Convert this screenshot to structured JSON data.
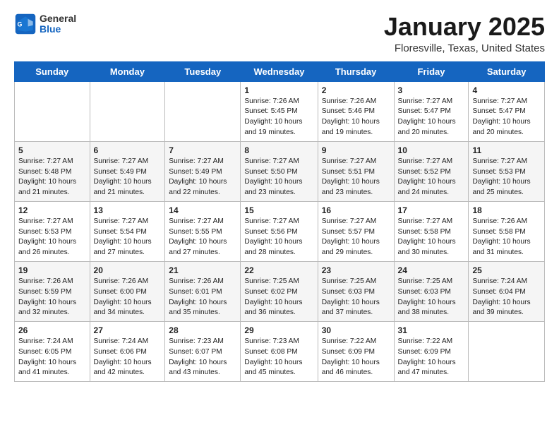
{
  "header": {
    "logo_general": "General",
    "logo_blue": "Blue",
    "month_title": "January 2025",
    "location": "Floresville, Texas, United States"
  },
  "days_of_week": [
    "Sunday",
    "Monday",
    "Tuesday",
    "Wednesday",
    "Thursday",
    "Friday",
    "Saturday"
  ],
  "weeks": [
    [
      {
        "num": "",
        "info": ""
      },
      {
        "num": "",
        "info": ""
      },
      {
        "num": "",
        "info": ""
      },
      {
        "num": "1",
        "info": "Sunrise: 7:26 AM\nSunset: 5:45 PM\nDaylight: 10 hours\nand 19 minutes."
      },
      {
        "num": "2",
        "info": "Sunrise: 7:26 AM\nSunset: 5:46 PM\nDaylight: 10 hours\nand 19 minutes."
      },
      {
        "num": "3",
        "info": "Sunrise: 7:27 AM\nSunset: 5:47 PM\nDaylight: 10 hours\nand 20 minutes."
      },
      {
        "num": "4",
        "info": "Sunrise: 7:27 AM\nSunset: 5:47 PM\nDaylight: 10 hours\nand 20 minutes."
      }
    ],
    [
      {
        "num": "5",
        "info": "Sunrise: 7:27 AM\nSunset: 5:48 PM\nDaylight: 10 hours\nand 21 minutes."
      },
      {
        "num": "6",
        "info": "Sunrise: 7:27 AM\nSunset: 5:49 PM\nDaylight: 10 hours\nand 21 minutes."
      },
      {
        "num": "7",
        "info": "Sunrise: 7:27 AM\nSunset: 5:49 PM\nDaylight: 10 hours\nand 22 minutes."
      },
      {
        "num": "8",
        "info": "Sunrise: 7:27 AM\nSunset: 5:50 PM\nDaylight: 10 hours\nand 23 minutes."
      },
      {
        "num": "9",
        "info": "Sunrise: 7:27 AM\nSunset: 5:51 PM\nDaylight: 10 hours\nand 23 minutes."
      },
      {
        "num": "10",
        "info": "Sunrise: 7:27 AM\nSunset: 5:52 PM\nDaylight: 10 hours\nand 24 minutes."
      },
      {
        "num": "11",
        "info": "Sunrise: 7:27 AM\nSunset: 5:53 PM\nDaylight: 10 hours\nand 25 minutes."
      }
    ],
    [
      {
        "num": "12",
        "info": "Sunrise: 7:27 AM\nSunset: 5:53 PM\nDaylight: 10 hours\nand 26 minutes."
      },
      {
        "num": "13",
        "info": "Sunrise: 7:27 AM\nSunset: 5:54 PM\nDaylight: 10 hours\nand 27 minutes."
      },
      {
        "num": "14",
        "info": "Sunrise: 7:27 AM\nSunset: 5:55 PM\nDaylight: 10 hours\nand 27 minutes."
      },
      {
        "num": "15",
        "info": "Sunrise: 7:27 AM\nSunset: 5:56 PM\nDaylight: 10 hours\nand 28 minutes."
      },
      {
        "num": "16",
        "info": "Sunrise: 7:27 AM\nSunset: 5:57 PM\nDaylight: 10 hours\nand 29 minutes."
      },
      {
        "num": "17",
        "info": "Sunrise: 7:27 AM\nSunset: 5:58 PM\nDaylight: 10 hours\nand 30 minutes."
      },
      {
        "num": "18",
        "info": "Sunrise: 7:26 AM\nSunset: 5:58 PM\nDaylight: 10 hours\nand 31 minutes."
      }
    ],
    [
      {
        "num": "19",
        "info": "Sunrise: 7:26 AM\nSunset: 5:59 PM\nDaylight: 10 hours\nand 32 minutes."
      },
      {
        "num": "20",
        "info": "Sunrise: 7:26 AM\nSunset: 6:00 PM\nDaylight: 10 hours\nand 34 minutes."
      },
      {
        "num": "21",
        "info": "Sunrise: 7:26 AM\nSunset: 6:01 PM\nDaylight: 10 hours\nand 35 minutes."
      },
      {
        "num": "22",
        "info": "Sunrise: 7:25 AM\nSunset: 6:02 PM\nDaylight: 10 hours\nand 36 minutes."
      },
      {
        "num": "23",
        "info": "Sunrise: 7:25 AM\nSunset: 6:03 PM\nDaylight: 10 hours\nand 37 minutes."
      },
      {
        "num": "24",
        "info": "Sunrise: 7:25 AM\nSunset: 6:03 PM\nDaylight: 10 hours\nand 38 minutes."
      },
      {
        "num": "25",
        "info": "Sunrise: 7:24 AM\nSunset: 6:04 PM\nDaylight: 10 hours\nand 39 minutes."
      }
    ],
    [
      {
        "num": "26",
        "info": "Sunrise: 7:24 AM\nSunset: 6:05 PM\nDaylight: 10 hours\nand 41 minutes."
      },
      {
        "num": "27",
        "info": "Sunrise: 7:24 AM\nSunset: 6:06 PM\nDaylight: 10 hours\nand 42 minutes."
      },
      {
        "num": "28",
        "info": "Sunrise: 7:23 AM\nSunset: 6:07 PM\nDaylight: 10 hours\nand 43 minutes."
      },
      {
        "num": "29",
        "info": "Sunrise: 7:23 AM\nSunset: 6:08 PM\nDaylight: 10 hours\nand 45 minutes."
      },
      {
        "num": "30",
        "info": "Sunrise: 7:22 AM\nSunset: 6:09 PM\nDaylight: 10 hours\nand 46 minutes."
      },
      {
        "num": "31",
        "info": "Sunrise: 7:22 AM\nSunset: 6:09 PM\nDaylight: 10 hours\nand 47 minutes."
      },
      {
        "num": "",
        "info": ""
      }
    ]
  ]
}
